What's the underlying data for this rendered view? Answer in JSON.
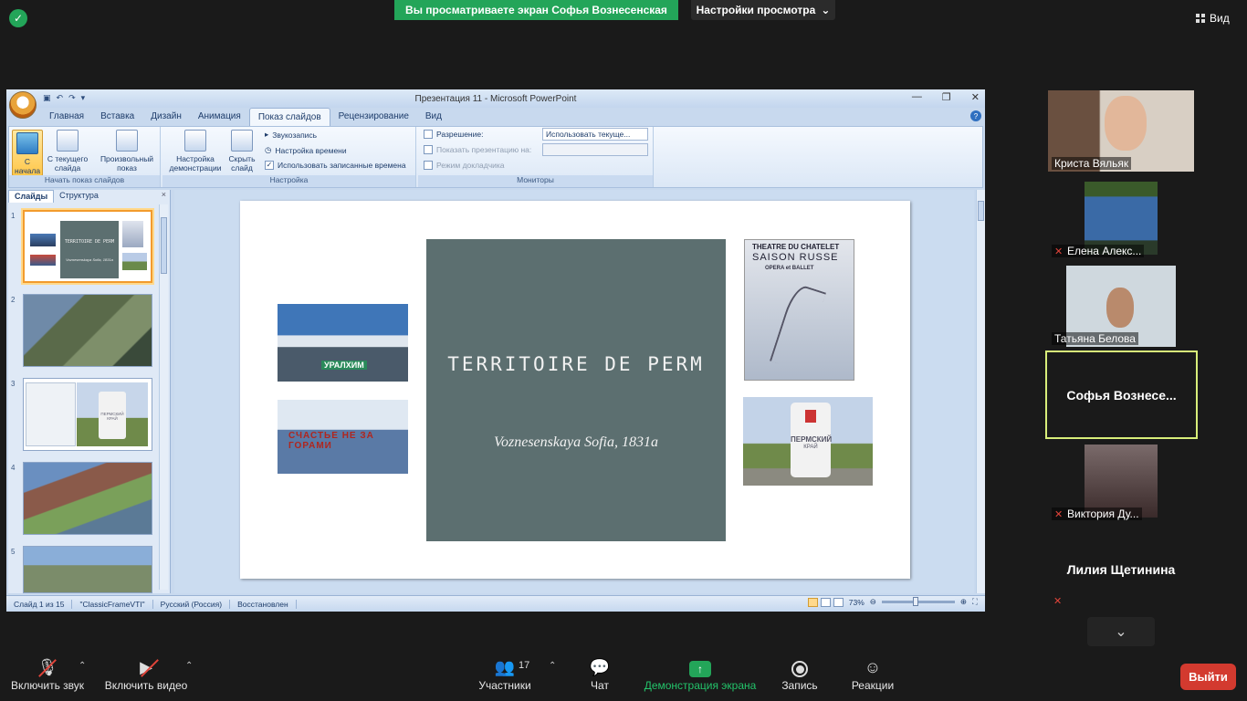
{
  "zoom": {
    "share_banner": "Вы просматриваете экран Софья Вознесенская",
    "view_options": "Настройки просмотра",
    "view_label": "Вид",
    "toolbar": {
      "mute": "Включить звук",
      "video": "Включить видео",
      "participants": "Участники",
      "participants_count": "17",
      "chat": "Чат",
      "share": "Демонстрация экрана",
      "record": "Запись",
      "reactions": "Реакции",
      "leave": "Выйти"
    },
    "participants": [
      {
        "name": "Криста Вяльяк",
        "muted": false
      },
      {
        "name": "Елена Алекс...",
        "muted": true
      },
      {
        "name": "Татьяна Белова",
        "muted": false
      },
      {
        "name": "Софья  Вознесе...",
        "muted": false,
        "active_speaker": true
      },
      {
        "name": "Виктория Ду...",
        "muted": true
      },
      {
        "name": "Лилия Щетинина",
        "muted": true
      }
    ]
  },
  "ppt": {
    "window_title": "Презентация 11 - Microsoft PowerPoint",
    "tabs": [
      "Главная",
      "Вставка",
      "Дизайн",
      "Анимация",
      "Показ слайдов",
      "Рецензирование",
      "Вид"
    ],
    "active_tab": "Показ слайдов",
    "ribbon": {
      "start_group_label": "Начать показ слайдов",
      "btn_start": "С начала",
      "btn_from_current": "С текущего слайда",
      "btn_custom": "Произвольный показ",
      "setup_group_label": "Настройка",
      "btn_setup": "Настройка демонстрации",
      "btn_hide": "Скрыть слайд",
      "record_narration": "Звукозапись",
      "rehearse_timings": "Настройка времени",
      "use_timings": "Использовать записанные времена",
      "monitors_group_label": "Мониторы",
      "resolution_label": "Разрешение:",
      "resolution_value": "Использовать текуще...",
      "show_on_label": "Показать презентацию на:",
      "presenter_view": "Режим докладчика"
    },
    "pane_tabs": [
      "Слайды",
      "Структура"
    ],
    "slide_numbers": [
      "1",
      "2",
      "3",
      "4",
      "5"
    ],
    "thumb1_title": "TERRITOIRE DE PERM",
    "thumb1_sub": "Voznesenskaya Sofia, 1831a",
    "thumb3_sign": "ПЕРМСКИЙ",
    "thumb3_sign2": "КРАЙ",
    "slide": {
      "title": "TERRITOIRE DE PERM",
      "subtitle": "Voznesenskaya Sofia, 1831a",
      "photo_uralchem": "УРАЛХИМ",
      "photo_happiness": "СЧАСТЬЕ НЕ ЗА ГОРАМИ",
      "poster_line1": "THEATRE DU CHATELET",
      "poster_line2": "SAISON RUSSE",
      "poster_line3": "OPERA et BALLET",
      "sign_line1": "ПЕРМСКИЙ",
      "sign_line2": "КРАЙ"
    },
    "status": {
      "slide_of": "Слайд 1 из 15",
      "theme": "\"ClassicFrameVTI\"",
      "language": "Русский (Россия)",
      "state": "Восстановлен",
      "zoom": "73%"
    }
  },
  "colors": {
    "zoom_green": "#23a559",
    "leave_red": "#d33a2f",
    "title_box": "#5c6f70",
    "active_speaker_border": "#d8ee7a"
  }
}
